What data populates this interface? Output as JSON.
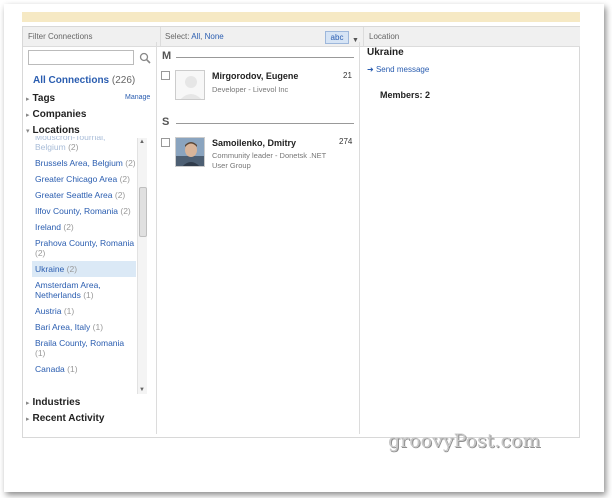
{
  "headers": {
    "filter": "Filter Connections",
    "select_prefix": "Select:",
    "select_all": "All",
    "select_none": "None",
    "sort_value": "abc",
    "location": "Location"
  },
  "sidebar": {
    "search_placeholder": "",
    "all_connections": "All Connections",
    "all_connections_count": "(226)",
    "tags": "Tags",
    "manage": "Manage",
    "companies": "Companies",
    "locations": "Locations",
    "industries": "Industries",
    "recent_activity": "Recent Activity",
    "location_items": [
      {
        "name": "Mouscron-Tournai, Belgium",
        "count": "(2)",
        "cut": true
      },
      {
        "name": "Brussels Area, Belgium",
        "count": "(2)"
      },
      {
        "name": "Greater Chicago Area",
        "count": "(2)"
      },
      {
        "name": "Greater Seattle Area",
        "count": "(2)"
      },
      {
        "name": "Ilfov County, Romania",
        "count": "(2)"
      },
      {
        "name": "Ireland",
        "count": "(2)"
      },
      {
        "name": "Prahova County, Romania",
        "count": "(2)"
      },
      {
        "name": "Ukraine",
        "count": "(2)",
        "selected": true
      },
      {
        "name": "Amsterdam Area, Netherlands",
        "count": "(1)"
      },
      {
        "name": "Austria",
        "count": "(1)"
      },
      {
        "name": "Bari Area, Italy",
        "count": "(1)"
      },
      {
        "name": "Braila County, Romania",
        "count": "(1)"
      },
      {
        "name": "Canada",
        "count": "(1)"
      }
    ]
  },
  "connections": {
    "group_m": "M",
    "group_s": "S",
    "c1_name": "Mirgorodov, Eugene",
    "c1_desc": "Developer - Livevol Inc",
    "c1_count": "21",
    "c2_name": "Samoilenko, Dmitry",
    "c2_desc": "Community leader - Donetsk .NET User Group",
    "c2_count": "274"
  },
  "detail": {
    "title": "Ukraine",
    "send_message": "Send message",
    "members_label": "Members:",
    "members_count": "2"
  },
  "watermark": "groovyPost.com",
  "colors": {
    "link": "#2a5db0",
    "selected_row": "#dbe9f6",
    "header_bg": "#f0f0f0",
    "top_bar": "#f6e9c4"
  }
}
